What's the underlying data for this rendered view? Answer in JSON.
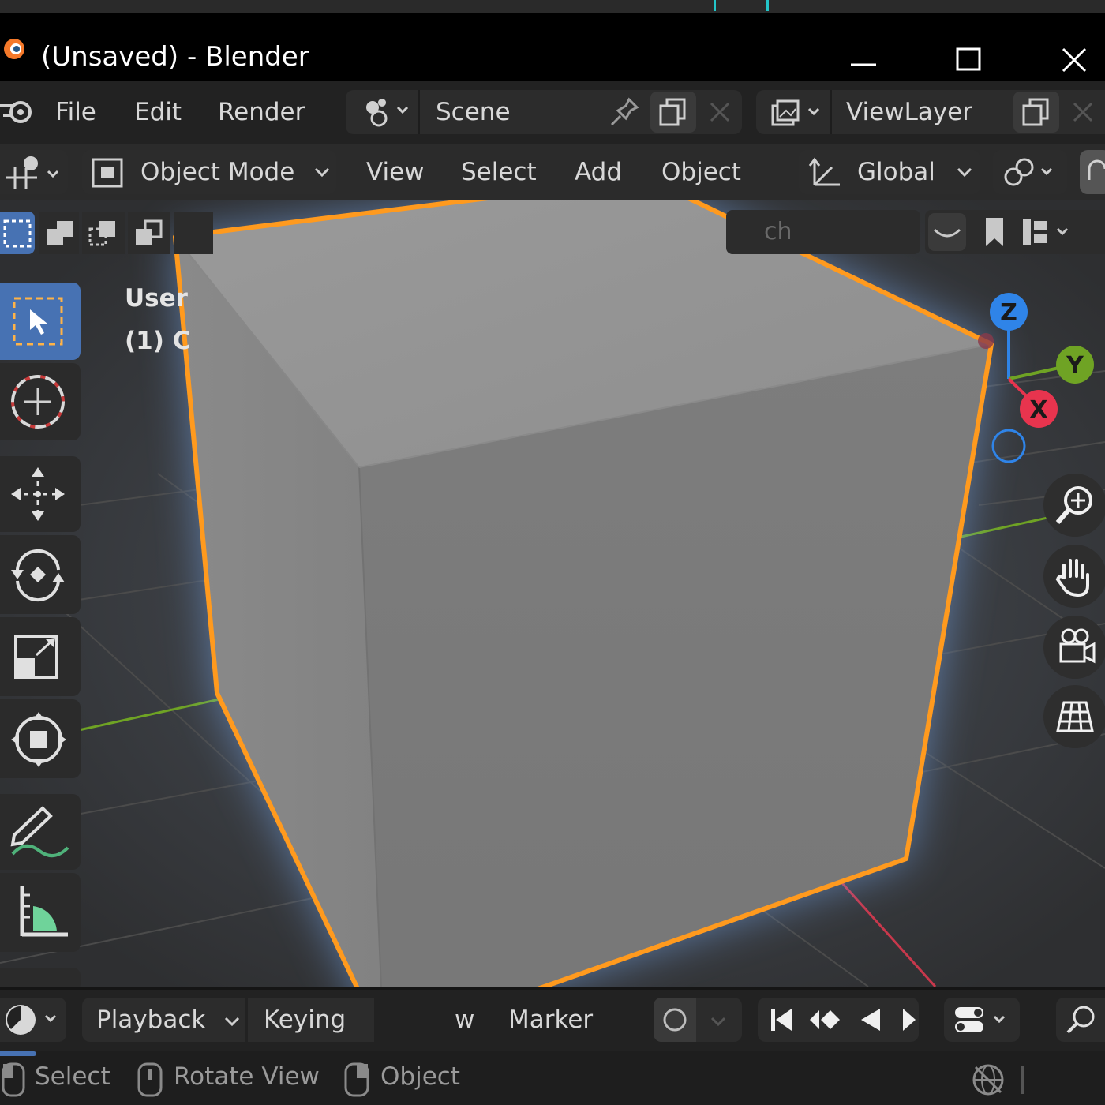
{
  "window": {
    "title": "(Unsaved) - Blender",
    "minimize_icon": "minimize-icon",
    "maximize_icon": "maximize-icon",
    "close_icon": "close-icon"
  },
  "menu": {
    "items": [
      "File",
      "Edit",
      "Render"
    ],
    "scene_label": "Scene",
    "viewlayer_label": "ViewLayer"
  },
  "header": {
    "mode": "Object Mode",
    "menus": [
      "View",
      "Select",
      "Add",
      "Object"
    ],
    "orientation": "Global"
  },
  "viewport": {
    "overlay_line1": "User",
    "overlay_line2": "(1) C",
    "search_fragment": "ch",
    "gizmo": {
      "z": "Z",
      "y": "Y",
      "x": "X"
    },
    "colors": {
      "selection": "#ff9a1e",
      "x_axis": "#e8344e",
      "y_axis": "#6fa324",
      "z_axis": "#2f84e8",
      "active_tool": "#4772b3"
    }
  },
  "toolbar": {
    "tools": [
      "select-box-icon",
      "cursor-icon",
      "move-icon",
      "rotate-icon",
      "scale-icon",
      "transform-icon",
      "annotate-icon",
      "measure-icon"
    ]
  },
  "navigation": {
    "buttons": [
      "zoom-icon",
      "pan-hand-icon",
      "camera-icon",
      "grid-icon"
    ]
  },
  "timeline": {
    "playback": "Playback",
    "keying": "Keying",
    "view_fragment": "w",
    "marker": "Marker"
  },
  "status": {
    "select": "Select",
    "rotate_view": "Rotate View",
    "object": "Object"
  }
}
